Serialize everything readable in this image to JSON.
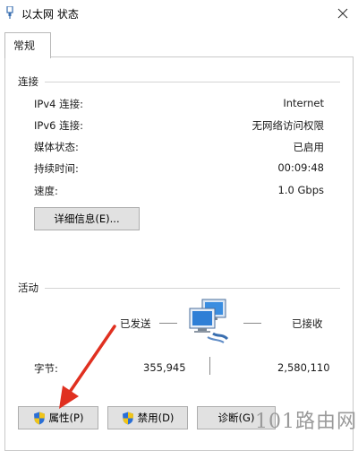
{
  "window": {
    "title": "以太网 状态",
    "close_label": "×"
  },
  "tabs": [
    {
      "label": "常规"
    }
  ],
  "connection": {
    "title": "连接",
    "rows": [
      {
        "label": "IPv4 连接:",
        "value": "Internet"
      },
      {
        "label": "IPv6 连接:",
        "value": "无网络访问权限"
      },
      {
        "label": "媒体状态:",
        "value": "已启用"
      },
      {
        "label": "持续时间:",
        "value": "00:09:48"
      },
      {
        "label": "速度:",
        "value": "1.0 Gbps"
      }
    ],
    "details_button": "详细信息(E)..."
  },
  "activity": {
    "title": "活动",
    "sent_label": "已发送",
    "received_label": "已接收",
    "bytes_label": "字节:",
    "bytes_sent": "355,945",
    "bytes_received": "2,580,110"
  },
  "buttons": {
    "properties": "属性(P)",
    "disable": "禁用(D)",
    "diagnose": "诊断(G)"
  },
  "watermark": "101路由网",
  "colors": {
    "arrow": "#e03020",
    "shield_blue": "#2a6fd6",
    "shield_yellow": "#f0c419"
  }
}
